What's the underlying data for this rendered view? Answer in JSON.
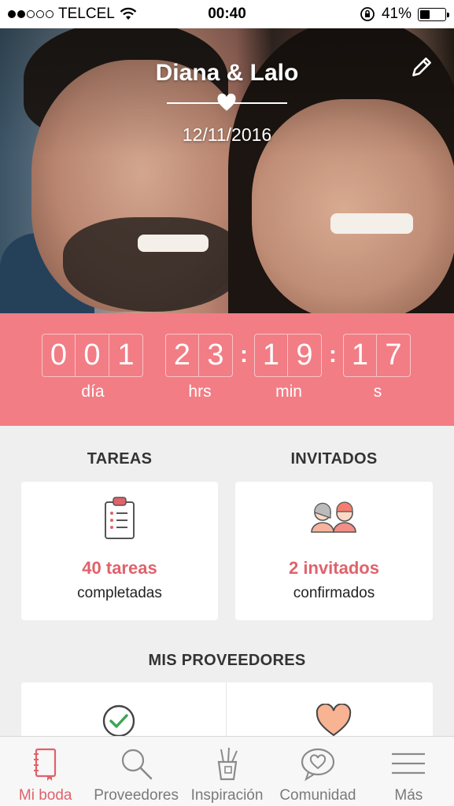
{
  "status_bar": {
    "carrier": "TELCEL",
    "time": "00:40",
    "battery": "41%",
    "battery_level": 0.41,
    "signal_dots_filled": 2,
    "signal_dots_total": 5,
    "icons": [
      "wifi-icon",
      "rotation-lock-icon",
      "battery-icon"
    ]
  },
  "hero": {
    "title": "Diana & Lalo",
    "date": "12/11/2016",
    "edit_icon": "pencil-icon"
  },
  "countdown": {
    "days": [
      "0",
      "0",
      "1"
    ],
    "hours": [
      "2",
      "3"
    ],
    "minutes": [
      "1",
      "9"
    ],
    "seconds": [
      "1",
      "7"
    ],
    "labels": {
      "days": "día",
      "hours": "hrs",
      "minutes": "min",
      "seconds": "s"
    },
    "background": "#f27d85"
  },
  "tareas": {
    "title": "TAREAS",
    "count": "40 tareas",
    "sub": "completadas",
    "icon": "clipboard-icon"
  },
  "invitados": {
    "title": "INVITADOS",
    "count": "2 invitados",
    "sub": "confirmados",
    "icon": "guests-icon"
  },
  "proveedores": {
    "title": "MIS PROVEEDORES",
    "icons": [
      "check-circle-icon",
      "heart-icon"
    ]
  },
  "tabbar": {
    "tabs": [
      {
        "label": "Mi boda",
        "icon": "notebook-icon",
        "active": true
      },
      {
        "label": "Proveedores",
        "icon": "search-icon",
        "active": false
      },
      {
        "label": "Inspiración",
        "icon": "pencil-cup-icon",
        "active": false
      },
      {
        "label": "Comunidad",
        "icon": "heart-bubble-icon",
        "active": false
      },
      {
        "label": "Más",
        "icon": "menu-icon",
        "active": false
      }
    ]
  },
  "colors": {
    "accent": "#e0626b",
    "countdown": "#f27d85",
    "background": "#efefef"
  }
}
